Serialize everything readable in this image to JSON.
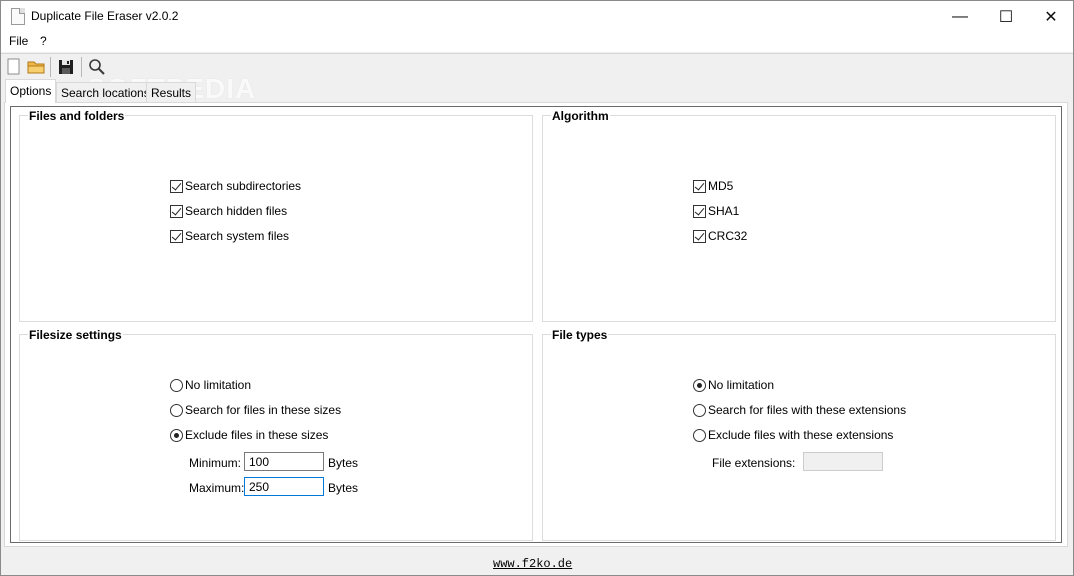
{
  "window": {
    "title": "Duplicate File Eraser v2.0.2"
  },
  "window_controls": {
    "minimize": "—",
    "maximize": "☐",
    "close": "✕"
  },
  "menu": [
    "File",
    "?"
  ],
  "toolbar": {
    "icons": [
      "new-icon",
      "open-folder-icon",
      "save-icon",
      "search-icon"
    ]
  },
  "watermark": "SOFTPEDIA",
  "tabs": [
    {
      "label": "Options",
      "active": true
    },
    {
      "label": "Search locations",
      "active": false
    },
    {
      "label": "Results",
      "active": false
    }
  ],
  "files_and_folders": {
    "title": "Files and folders",
    "options": [
      {
        "label": "Search subdirectories",
        "checked": true
      },
      {
        "label": "Search hidden files",
        "checked": true
      },
      {
        "label": "Search system files",
        "checked": true
      }
    ]
  },
  "algorithm": {
    "title": "Algorithm",
    "options": [
      {
        "label": "MD5",
        "checked": true
      },
      {
        "label": "SHA1",
        "checked": true
      },
      {
        "label": "CRC32",
        "checked": true
      }
    ]
  },
  "filesize_settings": {
    "title": "Filesize settings",
    "options": [
      {
        "label": "No limitation",
        "checked": false
      },
      {
        "label": "Search for files in these sizes",
        "checked": false
      },
      {
        "label": "Exclude files in these sizes",
        "checked": true
      }
    ],
    "minimum_label": "Minimum:",
    "minimum_value": "100",
    "maximum_label": "Maximum:",
    "maximum_value": "250",
    "unit": "Bytes"
  },
  "file_types": {
    "title": "File types",
    "options": [
      {
        "label": "No limitation",
        "checked": true
      },
      {
        "label": "Search for files with these extensions",
        "checked": false
      },
      {
        "label": "Exclude files with these extensions",
        "checked": false
      }
    ],
    "extensions_label": "File extensions:",
    "extensions_value": ""
  },
  "footer": {
    "link": "www.f2ko.de"
  }
}
